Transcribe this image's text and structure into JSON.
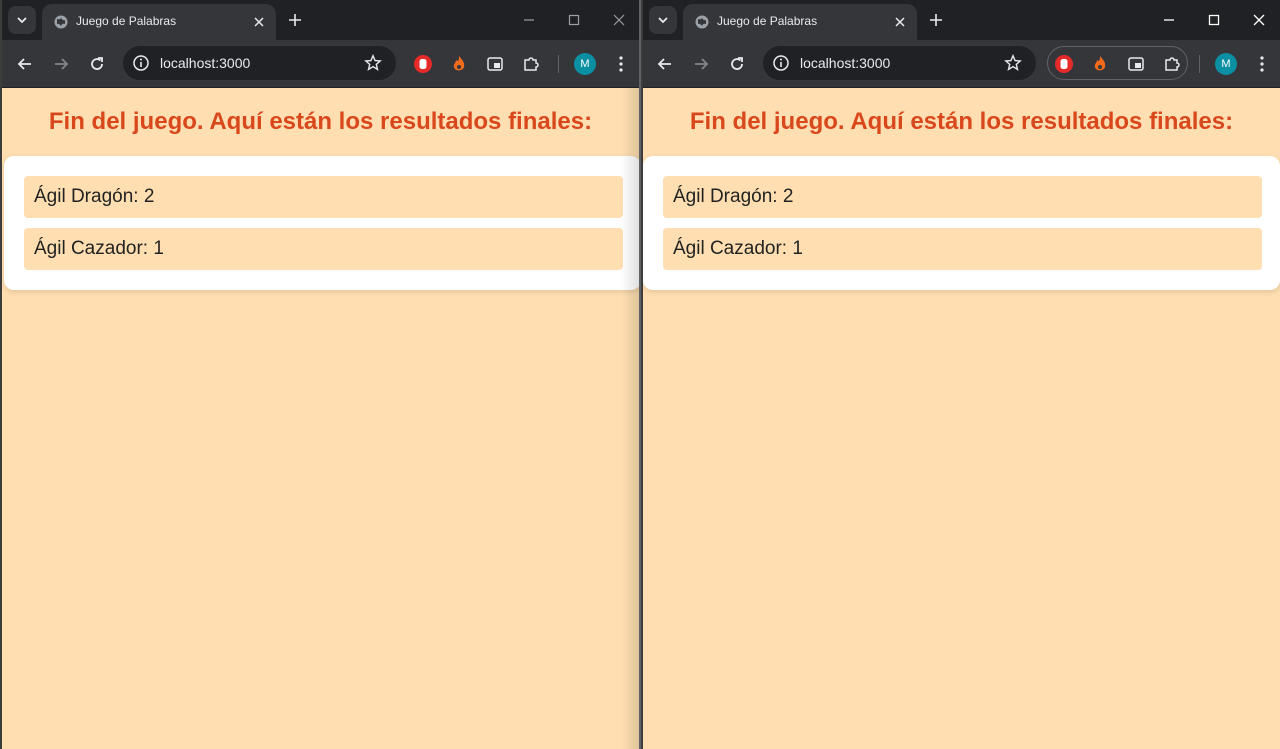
{
  "browser": {
    "tab_title": "Juego de Palabras",
    "url": "localhost:3000",
    "profile_initial": "M",
    "colors": {
      "frame": "#202124",
      "toolbar": "#35363a",
      "page_background": "#ffdfb1",
      "heading": "#d9481c",
      "avatar": "#0b8fa3"
    }
  },
  "page": {
    "heading": "Fin del juego. Aquí están los resultados finales:",
    "results": [
      {
        "text": "Ágil Dragón: 2"
      },
      {
        "text": "Ágil Cazador: 1"
      }
    ]
  },
  "icons": {
    "tab_search": "chevron-down-icon",
    "favicon": "globe-icon",
    "close": "close-icon",
    "new_tab": "plus-icon",
    "back": "arrow-left-icon",
    "forward": "arrow-right-icon",
    "reload": "reload-icon",
    "site_info": "info-icon",
    "bookmark": "star-icon",
    "extensions": [
      "stop-hand-icon",
      "fire-icon",
      "window-icon",
      "puzzle-icon"
    ],
    "menu": "more-vertical-icon",
    "minimize": "minimize-icon",
    "maximize": "maximize-icon",
    "window_close": "close-icon"
  }
}
